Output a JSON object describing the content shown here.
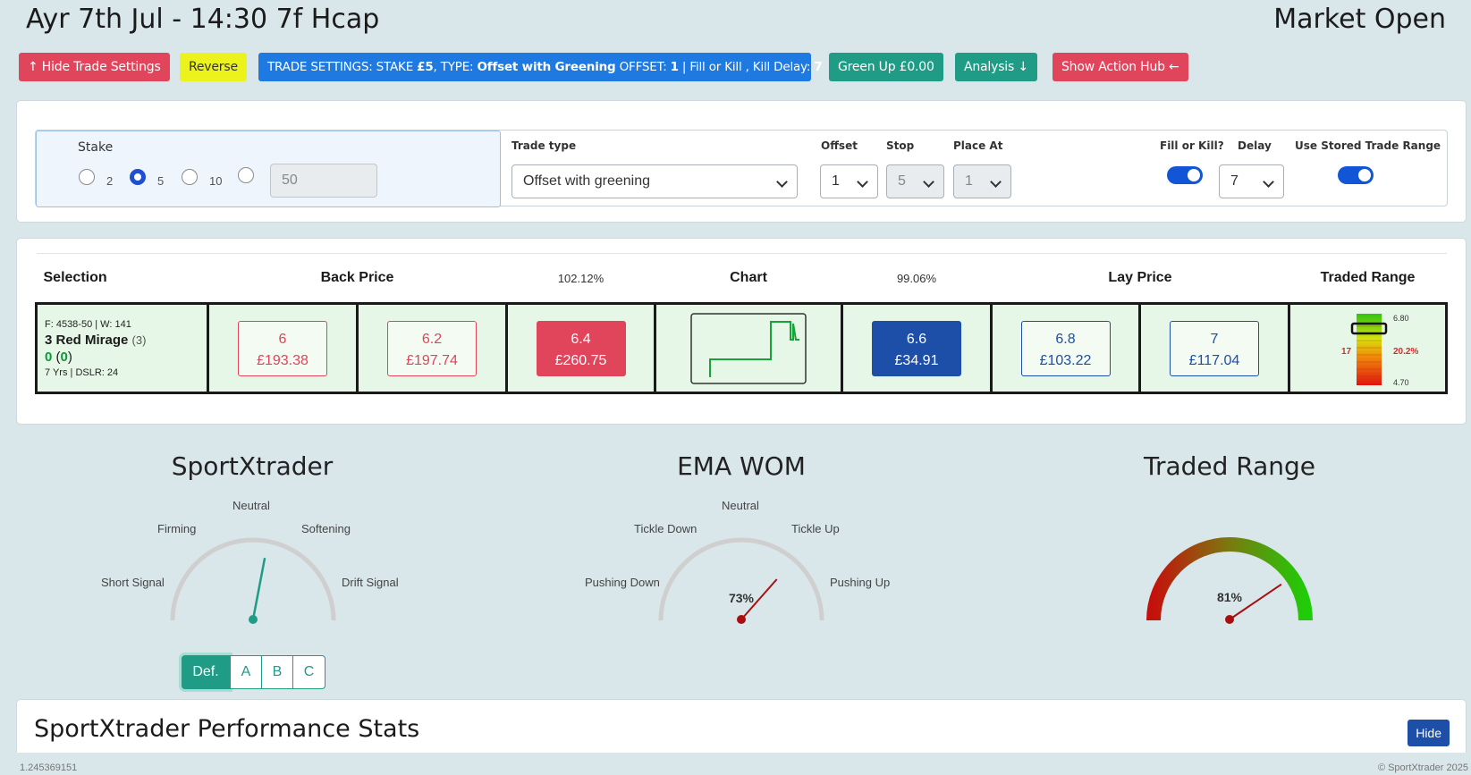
{
  "header": {
    "race_title": "Ayr 7th Jul - 14:30 7f Hcap",
    "market_status": "Market Open"
  },
  "toolbar": {
    "hide_settings": "↑ Hide Trade Settings",
    "reverse": "Reverse",
    "trade_settings_prefix": "TRADE SETTINGS: STAKE ",
    "trade_settings_stake": "£5",
    "trade_settings_type_lbl": ", TYPE: ",
    "trade_settings_type": "Offset with Greening",
    "trade_settings_offset_lbl": " OFFSET: ",
    "trade_settings_offset": "1",
    "trade_settings_fill": " | Fill or Kill , Kill Delay: ",
    "trade_settings_delay": "7",
    "green_up": "Green Up £0.00",
    "analysis": "Analysis ↓",
    "action_hub": "Show Action Hub ←"
  },
  "settings": {
    "stake_label": "Stake",
    "stake_options": [
      "2",
      "5",
      "10"
    ],
    "stake_selected": "5",
    "stake_custom_value": "50",
    "trade_type_label": "Trade type",
    "trade_type_value": "Offset with greening",
    "offset_label": "Offset",
    "offset_value": "1",
    "stop_label": "Stop",
    "stop_value": "5",
    "place_at_label": "Place At",
    "place_at_value": "1",
    "fill_kill_label": "Fill or Kill?",
    "fill_kill_on": true,
    "delay_label": "Delay",
    "delay_value": "7",
    "stored_range_label": "Use Stored Trade Range",
    "stored_range_on": true
  },
  "ladder": {
    "headers": {
      "selection": "Selection",
      "back_price": "Back Price",
      "back_pct": "102.12%",
      "chart": "Chart",
      "lay_pct": "99.06%",
      "lay_price": "Lay Price",
      "traded_range": "Traded Range"
    },
    "runner": {
      "form": "F: 4538-50 | W: 141",
      "name": "3 Red Mirage",
      "draw": "(3)",
      "pl_main": "0",
      "pl_sub": "0",
      "info": "7 Yrs | DSLR: 24"
    },
    "back": [
      {
        "price": "6",
        "amount": "£193.38"
      },
      {
        "price": "6.2",
        "amount": "£197.74"
      },
      {
        "price": "6.4",
        "amount": "£260.75"
      }
    ],
    "lay": [
      {
        "price": "6.6",
        "amount": "£34.91"
      },
      {
        "price": "6.8",
        "amount": "£103.22"
      },
      {
        "price": "7",
        "amount": "£117.04"
      }
    ],
    "range": {
      "high": "6.80",
      "low": "4.70",
      "left": "17",
      "pct": "20.2%"
    }
  },
  "gauges": {
    "sportx": {
      "title": "SportXtrader",
      "neutral": "Neutral",
      "firming": "Firming",
      "softening": "Softening",
      "short_signal": "Short Signal",
      "drift_signal": "Drift Signal",
      "needle_level": 0.56,
      "color": "#1f9b86"
    },
    "ema": {
      "title": "EMA WOM",
      "neutral": "Neutral",
      "tickle_down": "Tickle Down",
      "tickle_up": "Tickle Up",
      "pushing_down": "Pushing Down",
      "pushing_up": "Pushing Up",
      "value": "73%",
      "level": 0.73
    },
    "range": {
      "title": "Traded Range",
      "value": "81%",
      "level": 0.81
    },
    "modes": [
      "Def.",
      "A",
      "B",
      "C"
    ],
    "active_mode": "Def."
  },
  "stats": {
    "title": "SportXtrader Performance Stats",
    "hide": "Hide"
  },
  "footer": {
    "market_id": "1.245369151",
    "copyright": "© SportXtrader 2025"
  }
}
